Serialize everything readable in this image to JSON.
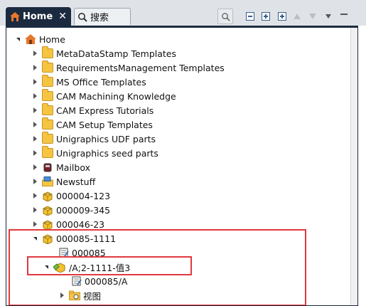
{
  "tabs": [
    {
      "label": "Home",
      "active": true,
      "icon": "home-icon"
    },
    {
      "label": "搜索",
      "active": false,
      "icon": "search-icon"
    }
  ],
  "toolbar": {
    "buttons": [
      "search-icon",
      "collapse-all-icon",
      "expand-icon",
      "expand-all-icon",
      "move-up-icon",
      "move-down-icon",
      "view-menu-icon"
    ]
  },
  "tree": {
    "root": "Home",
    "items": [
      {
        "label": "MetaDataStamp Templates",
        "icon": "folder-icon"
      },
      {
        "label": "RequirementsManagement Templates",
        "icon": "folder-icon"
      },
      {
        "label": "MS Office Templates",
        "icon": "folder-icon"
      },
      {
        "label": "CAM Machining Knowledge",
        "icon": "folder-icon"
      },
      {
        "label": "CAM Express Tutorials",
        "icon": "folder-icon"
      },
      {
        "label": "CAM Setup Templates",
        "icon": "folder-icon"
      },
      {
        "label": "Unigraphics UDF parts",
        "icon": "folder-icon"
      },
      {
        "label": "Unigraphics seed parts",
        "icon": "folder-icon"
      },
      {
        "label": "Mailbox",
        "icon": "mailbox-icon"
      },
      {
        "label": "Newstuff",
        "icon": "newstuff-folder-icon"
      },
      {
        "label": "000004-123",
        "icon": "item-icon"
      },
      {
        "label": "000009-345",
        "icon": "item-icon"
      },
      {
        "label": "000046-23",
        "icon": "item-icon"
      }
    ],
    "expanded_item": {
      "label": "000085-1111",
      "children": {
        "master": "000085",
        "revision": "/A;2-1111-值3",
        "revision_children": {
          "dataset": "000085/A",
          "view": "视图"
        }
      }
    }
  },
  "colors": {
    "tab_active_bg": "#1b2a3f",
    "highlight_border": "#e0393e",
    "folder_fill": "#f5c542"
  }
}
